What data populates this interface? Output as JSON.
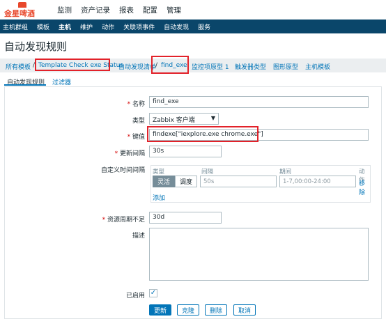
{
  "logo": {
    "brand": "金星啤酒"
  },
  "topmenu": [
    "监测",
    "资产记录",
    "报表",
    "配置",
    "管理"
  ],
  "subnav": [
    "主机群组",
    "模板",
    "主机",
    "维护",
    "动作",
    "关联项事件",
    "自动发现",
    "服务"
  ],
  "page_title": "自动发现规则",
  "breadcrumbs": {
    "all_templates": "所有模板",
    "sep": "/",
    "template": "Template Check exe Status",
    "discovery_list": "自动发现清单",
    "rule": "find_exe",
    "item_prototypes": "监控项原型 1",
    "trigger_types": "触发器类型",
    "graph_prototypes": "图形原型",
    "host_templates": "主机模板"
  },
  "tabs": {
    "rule": "自动发现规则",
    "filters": "过滤器"
  },
  "form": {
    "req_mark": "*",
    "name_label": "名称",
    "name_value": "find_exe",
    "type_label": "类型",
    "type_value": "Zabbix 客户端",
    "key_label": "键值",
    "key_value": "findexe[\"iexplore.exe chrome.exe\"]",
    "interval_label": "更新间隔",
    "interval_value": "30s",
    "custom_interval_label": "自定义时间间隔",
    "sched_headers": {
      "type": "类型",
      "interval": "间隔",
      "period": "期间",
      "action": "动作"
    },
    "sched_flexible": "灵活",
    "sched_scheduling": "调度",
    "sched_interval_ph": "50s",
    "sched_period_ph": "1-7,00:00-24:00",
    "sched_remove": "移除",
    "sched_add": "添加",
    "lifetime_label": "资源周期不足",
    "lifetime_value": "30d",
    "desc_label": "描述",
    "enabled_label": "已启用",
    "enabled_mark": "✓"
  },
  "buttons": {
    "update": "更新",
    "clone": "克隆",
    "delete": "删除",
    "cancel": "取消"
  },
  "colors": {
    "nav": "#0a466a",
    "link": "#0275b8",
    "highlight": "#e2222a"
  }
}
